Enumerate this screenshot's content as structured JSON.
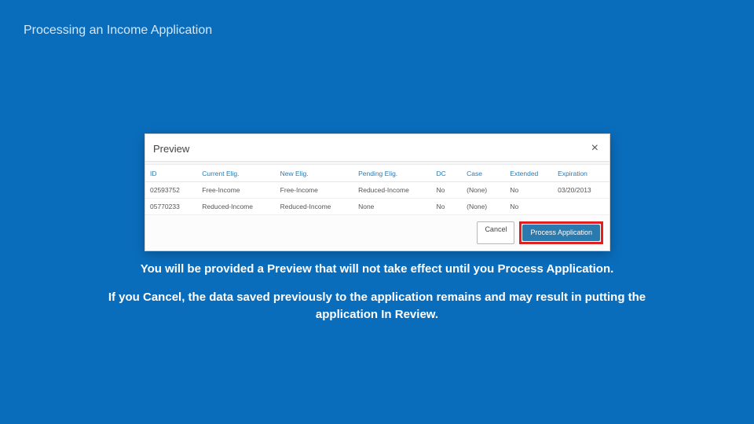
{
  "slide": {
    "title": "Processing an Income Application",
    "caption1": "You will be provided a Preview that will not take effect until you Process Application.",
    "caption2": "If you Cancel, the data saved previously to the application remains and may result in putting the application In Review."
  },
  "dialog": {
    "title": "Preview",
    "close_glyph": "×",
    "cancel_label": "Cancel",
    "process_label": "Process Application",
    "columns": {
      "id": "ID",
      "current": "Current Elig.",
      "new": "New Elig.",
      "pending": "Pending Elig.",
      "dc": "DC",
      "case": "Case",
      "extended": "Extended",
      "expiration": "Expiration"
    },
    "rows": [
      {
        "id": "02593752",
        "current": "Free-Income",
        "new": "Free-Income",
        "pending": "Reduced-Income",
        "dc": "No",
        "case": "(None)",
        "extended": "No",
        "expiration": "03/20/2013"
      },
      {
        "id": "05770233",
        "current": "Reduced-Income",
        "new": "Reduced-Income",
        "pending": "None",
        "dc": "No",
        "case": "(None)",
        "extended": "No",
        "expiration": ""
      }
    ]
  }
}
